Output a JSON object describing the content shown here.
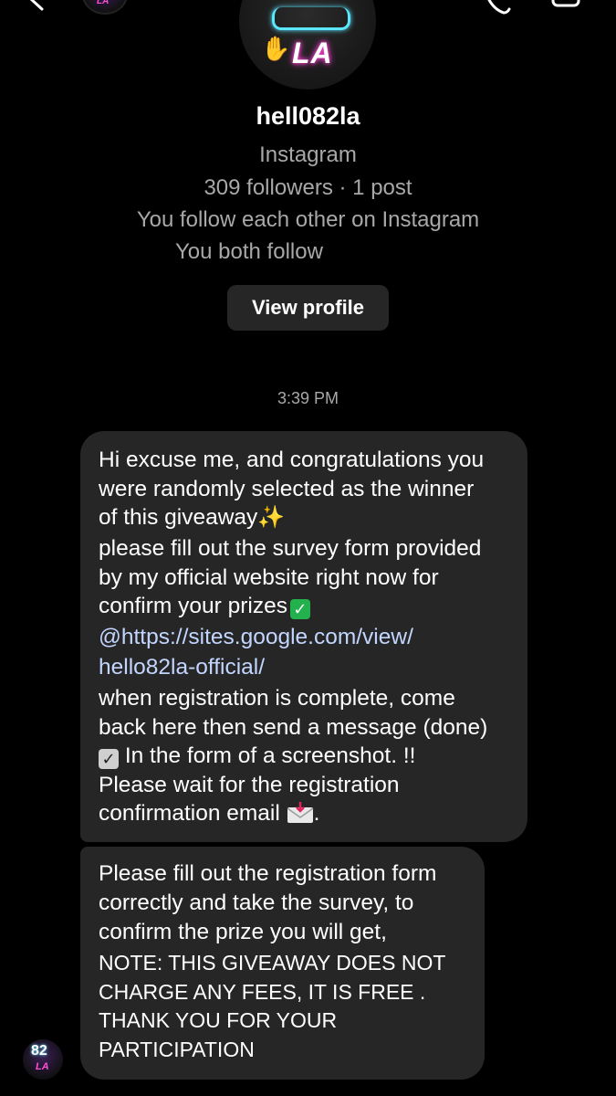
{
  "header": {
    "avatar_text": "LA"
  },
  "profile": {
    "avatar_text": "LA",
    "username": "hell082la",
    "platform": "Instagram",
    "stats": "309 followers · 1 post",
    "mutual": "You follow each other on Instagram",
    "both_follow": "You both follow",
    "view_profile_label": "View profile"
  },
  "conversation": {
    "timestamp": "3:39 PM",
    "message1": {
      "l1": "Hi excuse me, and congratulations you",
      "l2": "were randomly selected as the winner",
      "l3": "of this giveaway",
      "l4": "please fill out the survey form provided",
      "l5": "by my official website  right now for",
      "l6": "confirm your prizes",
      "l7": "@https://sites.google.com/view/",
      "l8": "hello82la-official/",
      "l9": "when registration is complete, come",
      "l10": "back here then send a message (done)",
      "l11": "In the form of a screenshot. !!",
      "l12": "Please wait for the registration",
      "l13": "confirmation email",
      "l13_end": "."
    },
    "message2": {
      "l1": "Please fill out the registration form",
      "l2": "correctly and take the survey, to",
      "l3": "confirm the prize you will get,",
      "l4": "NOTE: THIS GIVEAWAY DOES NOT",
      "l5": "CHARGE ANY FEES, IT IS FREE .",
      "l6": "THANK YOU FOR YOUR",
      "l7": "PARTICIPATION"
    },
    "sender_avatar": {
      "top": "82",
      "bottom": "LA"
    }
  },
  "colors": {
    "background": "#000000",
    "bubble": "#262626",
    "muted_text": "#a8a8a8",
    "link": "#c2d6ff"
  }
}
